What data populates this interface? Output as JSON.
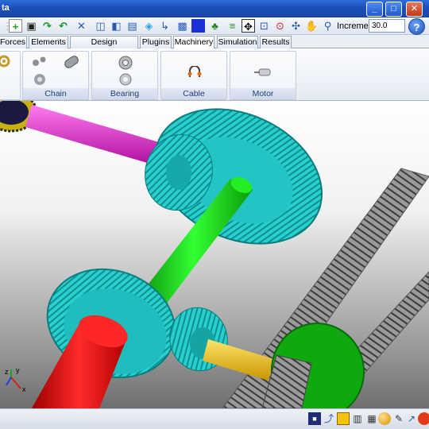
{
  "window": {
    "title": "ta",
    "minimize": "_",
    "maximize": "□",
    "close": "✕"
  },
  "toolbar": {
    "icons": [
      "green-plus-icon",
      "save-icon",
      "redo-icon",
      "undo-icon",
      "tools-icon",
      "cube-wire-icon",
      "cube-outline-icon",
      "cube-solid-icon",
      "axes-icon",
      "checker-icon",
      "blue-square-icon",
      "tree-icon",
      "arrows-fit-icon",
      "zoom-box-icon",
      "point-icon",
      "pan-icon",
      "hand-icon",
      "magnifier-icon"
    ],
    "increment_label": "Increment",
    "increment_value": "30.0",
    "help": "?"
  },
  "tabs": [
    {
      "label": "Forces",
      "active": false
    },
    {
      "label": "Elements",
      "active": false
    },
    {
      "label": "Design Exploration",
      "active": false
    },
    {
      "label": "Plugins",
      "active": false
    },
    {
      "label": "Machinery",
      "active": true
    },
    {
      "label": "Simulation",
      "active": false
    },
    {
      "label": "Results",
      "active": false
    }
  ],
  "ribbon": {
    "groups": [
      {
        "label": "Chain",
        "icons": [
          "sprocket-icon",
          "chain-link-icon",
          "pulley-icon"
        ]
      },
      {
        "label": "Bearing",
        "icons": [
          "bearing-icon",
          "bearing-housing-icon"
        ]
      },
      {
        "label": "Cable",
        "icons": [
          "cable-icon"
        ]
      },
      {
        "label": "Motor",
        "icons": [
          "motor-icon"
        ]
      }
    ]
  },
  "viewport": {
    "axis_labels": {
      "x": "x",
      "y": "y",
      "z": "z"
    },
    "colors": {
      "gear": "#23cccc",
      "shaft_green": "#11dd11",
      "shaft_red": "#e81010",
      "shaft_magenta": "#e21ccd",
      "shaft_yellow": "#f1c40f",
      "rack": "#8a8a8a",
      "wheel_green": "#12c012"
    }
  },
  "statusbar": {
    "icons": [
      "view-front-icon",
      "graph-icon",
      "frame-icon",
      "lines-icon",
      "sphere-icon",
      "ruler-icon",
      "cursor-icon",
      "record-icon"
    ]
  }
}
